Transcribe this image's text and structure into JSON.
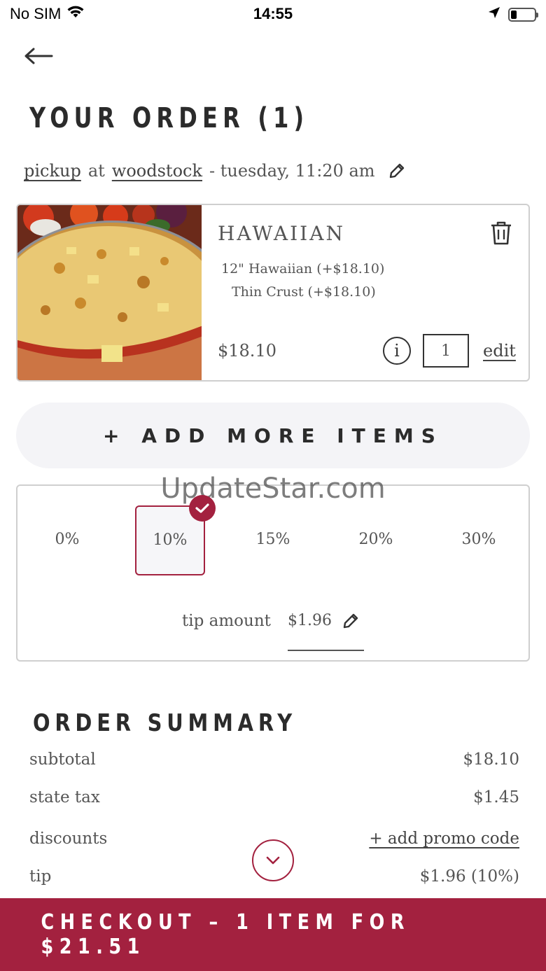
{
  "colors": {
    "accent": "#a3213f",
    "border": "#cfcfcf",
    "text": "#555555",
    "pill": "#f4f4f7"
  },
  "status_bar": {
    "carrier": "No SIM",
    "time": "14:55",
    "battery_level": 0.25
  },
  "header": {
    "title": "YOUR ORDER (1)"
  },
  "order_meta": {
    "mode": "pickup",
    "at": "at",
    "location": "woodstock",
    "schedule": "- tuesday, 11:20 am"
  },
  "item": {
    "name": "HAWAIIAN",
    "options": [
      "12\" Hawaiian (+$18.10)",
      "Thin Crust (+$18.10)"
    ],
    "price": "$18.10",
    "quantity": "1",
    "info_label": "i",
    "edit_label": "edit",
    "image_icon": "pizza-photo"
  },
  "add_more": {
    "label": "+ ADD MORE ITEMS"
  },
  "watermark": "UpdateStar.com",
  "tip": {
    "options": [
      "0%",
      "10%",
      "15%",
      "20%",
      "30%"
    ],
    "selected": "10%",
    "amount_label": "tip amount",
    "amount_value": "$1.96"
  },
  "summary": {
    "title": "ORDER SUMMARY",
    "rows": [
      {
        "label": "subtotal",
        "value": "$18.10"
      },
      {
        "label": "state tax",
        "value": "$1.45"
      },
      {
        "label": "discounts",
        "value": "+ add promo code"
      },
      {
        "label": "tip",
        "value": "$1.96 (10%)"
      }
    ]
  },
  "checkout": {
    "label": "CHECKOUT – 1 ITEM FOR $21.51"
  }
}
